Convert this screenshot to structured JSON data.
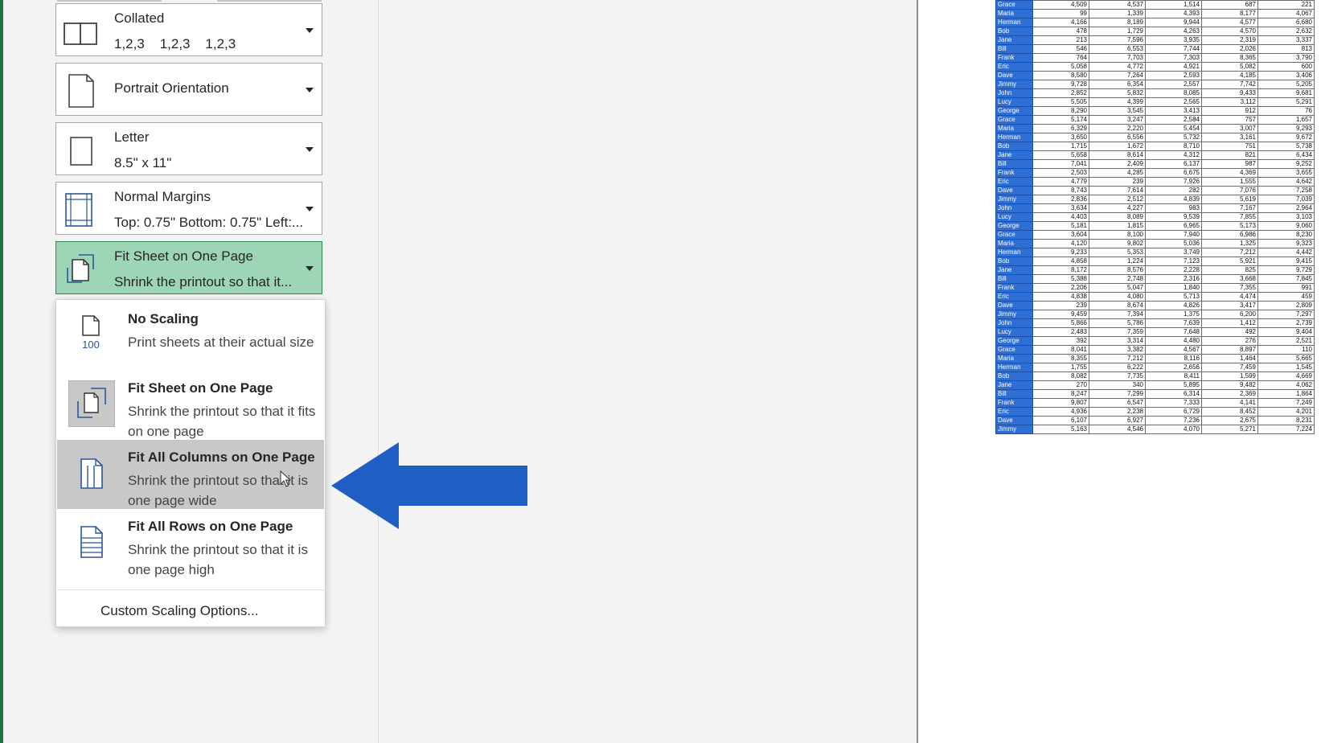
{
  "print_settings": {
    "collation": {
      "title": "Collated",
      "subtitle": "1,2,3    1,2,3    1,2,3"
    },
    "orientation": {
      "title": "Portrait Orientation"
    },
    "paper_size": {
      "title": "Letter",
      "subtitle": "8.5\" x 11\""
    },
    "margins": {
      "title": "Normal Margins",
      "subtitle": "Top: 0.75\" Bottom: 0.75\" Left:..."
    },
    "scaling": {
      "title": "Fit Sheet on One Page",
      "subtitle": "Shrink the printout so that it..."
    }
  },
  "scaling_menu": {
    "items": [
      {
        "title": "No Scaling",
        "description": "Print sheets at their actual size",
        "icon": "page-100-icon",
        "icon_label": "100"
      },
      {
        "title": "Fit Sheet on One Page",
        "description": "Shrink the printout so that it fits on one page",
        "icon": "fit-sheet-icon"
      },
      {
        "title": "Fit All Columns on One Page",
        "description": "Shrink the printout so that it is one page wide",
        "icon": "fit-columns-icon",
        "selected": true
      },
      {
        "title": "Fit All Rows on One Page",
        "description": "Shrink the printout so that it is one page high",
        "icon": "fit-rows-icon"
      }
    ],
    "custom_option": "Custom Scaling Options..."
  },
  "annotation": {
    "arrow_color": "#1f5fc4",
    "icon": "arrow-left-icon"
  },
  "colors": {
    "accent": "#217346",
    "active_setting": "#9fd5b7",
    "name_cell": "#2e6fd6"
  },
  "preview_table": {
    "rows": [
      [
        "Grace",
        "4,509",
        "4,537",
        "1,514",
        "687",
        "221"
      ],
      [
        "Maria",
        "99",
        "1,339",
        "4,393",
        "8,177",
        "4,067"
      ],
      [
        "Herman",
        "4,166",
        "8,189",
        "9,944",
        "4,577",
        "6,680"
      ],
      [
        "Bob",
        "478",
        "1,729",
        "4,263",
        "4,570",
        "2,632"
      ],
      [
        "Jane",
        "213",
        "7,596",
        "3,935",
        "2,319",
        "3,337"
      ],
      [
        "Bill",
        "546",
        "6,553",
        "7,744",
        "2,026",
        "813"
      ],
      [
        "Frank",
        "764",
        "7,703",
        "7,303",
        "8,365",
        "3,790"
      ],
      [
        "Eric",
        "5,058",
        "4,772",
        "4,921",
        "5,082",
        "600"
      ],
      [
        "Dave",
        "8,580",
        "7,264",
        "2,593",
        "4,185",
        "3,406"
      ],
      [
        "Jimmy",
        "9,728",
        "6,354",
        "2,557",
        "7,742",
        "5,205"
      ],
      [
        "John",
        "2,852",
        "5,832",
        "8,085",
        "9,433",
        "9,681"
      ],
      [
        "Lucy",
        "5,505",
        "4,399",
        "2,565",
        "3,112",
        "5,291"
      ],
      [
        "George",
        "8,290",
        "3,545",
        "3,413",
        "912",
        "76"
      ],
      [
        "Grace",
        "5,174",
        "3,247",
        "2,584",
        "757",
        "1,657"
      ],
      [
        "Maria",
        "6,329",
        "2,220",
        "5,454",
        "3,007",
        "9,293"
      ],
      [
        "Herman",
        "3,650",
        "6,556",
        "5,732",
        "3,161",
        "9,672"
      ],
      [
        "Bob",
        "1,715",
        "1,672",
        "8,710",
        "751",
        "5,738"
      ],
      [
        "Jane",
        "5,658",
        "8,614",
        "4,312",
        "821",
        "6,434"
      ],
      [
        "Bill",
        "7,041",
        "2,409",
        "6,137",
        "987",
        "9,252"
      ],
      [
        "Frank",
        "2,503",
        "4,285",
        "6,675",
        "4,369",
        "3,655"
      ],
      [
        "Eric",
        "4,779",
        "239",
        "7,926",
        "1,555",
        "4,642"
      ],
      [
        "Dave",
        "8,743",
        "7,614",
        "282",
        "7,076",
        "7,258"
      ],
      [
        "Jimmy",
        "2,836",
        "2,512",
        "4,839",
        "5,619",
        "7,039"
      ],
      [
        "John",
        "3,634",
        "4,227",
        "983",
        "7,167",
        "2,964"
      ],
      [
        "Lucy",
        "4,403",
        "8,089",
        "9,539",
        "7,855",
        "3,103"
      ],
      [
        "George",
        "5,181",
        "1,815",
        "6,965",
        "5,173",
        "9,060"
      ],
      [
        "Grace",
        "3,604",
        "8,100",
        "7,940",
        "6,986",
        "8,230"
      ],
      [
        "Maria",
        "4,120",
        "9,802",
        "5,036",
        "1,325",
        "9,323"
      ],
      [
        "Herman",
        "9,233",
        "5,353",
        "3,749",
        "7,212",
        "4,442"
      ],
      [
        "Bob",
        "4,858",
        "1,224",
        "7,123",
        "5,921",
        "9,415"
      ],
      [
        "Jane",
        "8,172",
        "8,576",
        "2,228",
        "825",
        "9,729"
      ],
      [
        "Bill",
        "5,388",
        "2,748",
        "2,316",
        "3,668",
        "7,845"
      ],
      [
        "Frank",
        "2,206",
        "5,047",
        "1,840",
        "7,355",
        "991"
      ],
      [
        "Eric",
        "4,838",
        "4,080",
        "5,713",
        "4,474",
        "459"
      ],
      [
        "Dave",
        "239",
        "8,674",
        "4,826",
        "3,417",
        "2,809"
      ],
      [
        "Jimmy",
        "9,459",
        "7,394",
        "1,375",
        "6,200",
        "7,297"
      ],
      [
        "John",
        "5,866",
        "5,786",
        "7,639",
        "1,412",
        "2,739"
      ],
      [
        "Lucy",
        "2,483",
        "7,359",
        "7,648",
        "492",
        "9,404"
      ],
      [
        "George",
        "392",
        "3,314",
        "4,480",
        "276",
        "2,521"
      ],
      [
        "Grace",
        "8,041",
        "3,382",
        "4,567",
        "8,897",
        "110"
      ],
      [
        "Maria",
        "8,355",
        "7,212",
        "8,116",
        "1,464",
        "5,665"
      ],
      [
        "Herman",
        "1,755",
        "6,222",
        "2,656",
        "7,459",
        "1,545"
      ],
      [
        "Bob",
        "8,082",
        "7,735",
        "8,411",
        "1,599",
        "4,669"
      ],
      [
        "Jane",
        "270",
        "340",
        "5,895",
        "9,482",
        "4,062"
      ],
      [
        "Bill",
        "8,247",
        "7,299",
        "6,314",
        "2,369",
        "1,864"
      ],
      [
        "Frank",
        "9,807",
        "6,547",
        "7,333",
        "4,141",
        "7,249"
      ],
      [
        "Eric",
        "4,936",
        "2,238",
        "6,729",
        "8,452",
        "4,201"
      ],
      [
        "Dave",
        "6,107",
        "6,927",
        "7,236",
        "2,675",
        "8,231"
      ],
      [
        "Jimmy",
        "5,163",
        "4,546",
        "4,070",
        "5,271",
        "7,224"
      ]
    ]
  }
}
